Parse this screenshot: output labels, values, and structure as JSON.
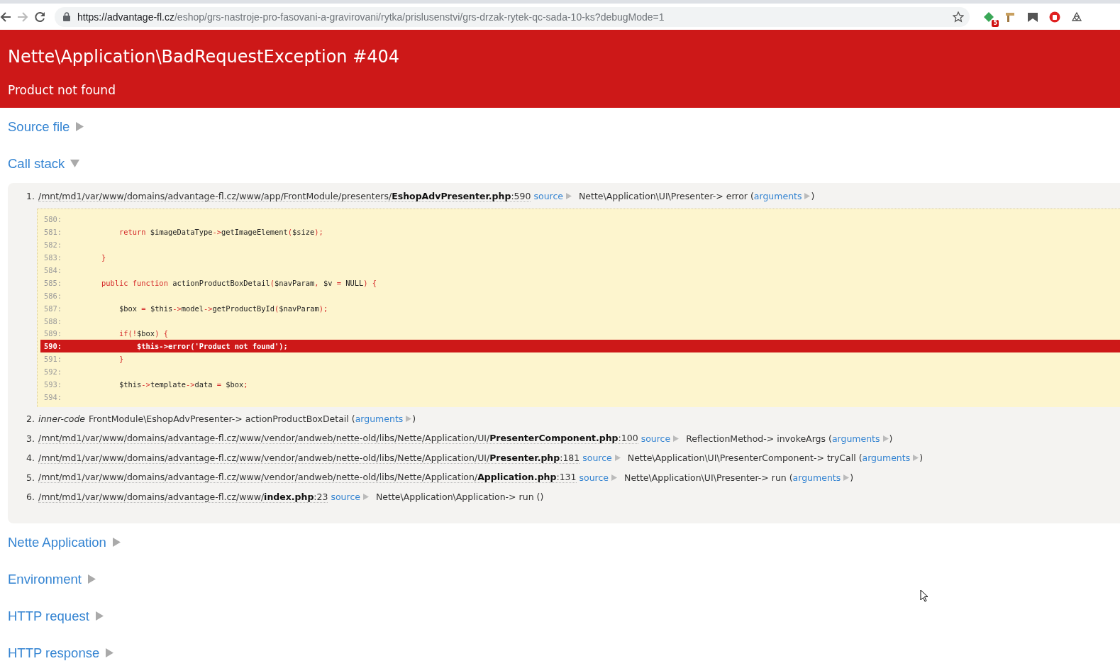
{
  "browser": {
    "back_disabled": false,
    "forward_disabled": true,
    "url_host": "https://advantage-fl.cz",
    "url_path": "/eshop/grs-nastroje-pro-fasovani-a-gravirovani/rytka/prislusenstvi/grs-drzak-rytek-qc-sada-10-ks?debugMode=1",
    "extension_badge": "5"
  },
  "error": {
    "title": "Nette\\Application\\BadRequestException #404",
    "message": "Product not found"
  },
  "sections": [
    {
      "title": "Source file",
      "expanded": false
    },
    {
      "title": "Call stack",
      "expanded": true,
      "frames": [
        {
          "kind": "file",
          "number": "1.",
          "location": "/mnt/md1/var/www/domains/advantage-fl.cz/www/app/FrontModule/presenters/**EshopAdvPresenter.php**:590",
          "source_link": "source",
          "call": "Nette\\Application\\UI\\Presenter-> error (",
          "arguments_link": "arguments",
          "close": ")",
          "code": [
            {
              "number": "580:",
              "highlighted": false
            },
            {
              "number": "581:",
              "highlighted": false,
              "segments": [
                {
                  "kind": "kw",
                  "text": "            return"
                },
                {
                  "kind": "tx",
                  "text": " $imageDataType"
                },
                {
                  "kind": "kw",
                  "text": "->"
                },
                {
                  "kind": "tx",
                  "text": "getImageElement"
                },
                {
                  "kind": "kw",
                  "text": "("
                },
                {
                  "kind": "tx",
                  "text": "$size"
                },
                {
                  "kind": "kw",
                  "text": ");"
                }
              ]
            },
            {
              "number": "582:",
              "highlighted": false
            },
            {
              "number": "583:",
              "highlighted": false,
              "segments": [
                {
                  "kind": "kw",
                  "text": "        }"
                }
              ]
            },
            {
              "number": "584:",
              "highlighted": false
            },
            {
              "number": "585:",
              "highlighted": false,
              "segments": [
                {
                  "kind": "kw",
                  "text": "        public function"
                },
                {
                  "kind": "tx",
                  "text": " actionProductBoxDetail"
                },
                {
                  "kind": "kw",
                  "text": "("
                },
                {
                  "kind": "tx",
                  "text": "$navParam"
                },
                {
                  "kind": "kw",
                  "text": ","
                },
                {
                  "kind": "tx",
                  "text": " $v "
                },
                {
                  "kind": "kw",
                  "text": "="
                },
                {
                  "kind": "tx",
                  "text": " NULL"
                },
                {
                  "kind": "kw",
                  "text": ") {"
                }
              ]
            },
            {
              "number": "586:",
              "highlighted": false
            },
            {
              "number": "587:",
              "highlighted": false,
              "segments": [
                {
                  "kind": "tx",
                  "text": "            $box "
                },
                {
                  "kind": "kw",
                  "text": "="
                },
                {
                  "kind": "tx",
                  "text": " $this"
                },
                {
                  "kind": "kw",
                  "text": "->"
                },
                {
                  "kind": "tx",
                  "text": "model"
                },
                {
                  "kind": "kw",
                  "text": "->"
                },
                {
                  "kind": "tx",
                  "text": "getProductById"
                },
                {
                  "kind": "kw",
                  "text": "("
                },
                {
                  "kind": "tx",
                  "text": "$navParam"
                },
                {
                  "kind": "kw",
                  "text": ");"
                }
              ]
            },
            {
              "number": "588:",
              "highlighted": false
            },
            {
              "number": "589:",
              "highlighted": false,
              "segments": [
                {
                  "kind": "kw",
                  "text": "            if(!"
                },
                {
                  "kind": "tx",
                  "text": "$box"
                },
                {
                  "kind": "kw",
                  "text": ") {"
                }
              ]
            },
            {
              "number": "590:",
              "highlighted": true,
              "segments": [
                {
                  "kind": "tx",
                  "text": "                $this->error('Product not found');"
                }
              ]
            },
            {
              "number": "591:",
              "highlighted": false,
              "segments": [
                {
                  "kind": "kw",
                  "text": "            }"
                }
              ]
            },
            {
              "number": "592:",
              "highlighted": false
            },
            {
              "number": "593:",
              "highlighted": false,
              "segments": [
                {
                  "kind": "tx",
                  "text": "            $this"
                },
                {
                  "kind": "kw",
                  "text": "->"
                },
                {
                  "kind": "tx",
                  "text": "template"
                },
                {
                  "kind": "kw",
                  "text": "->"
                },
                {
                  "kind": "tx",
                  "text": "data "
                },
                {
                  "kind": "kw",
                  "text": "="
                },
                {
                  "kind": "tx",
                  "text": " $box"
                },
                {
                  "kind": "kw",
                  "text": ";"
                }
              ]
            },
            {
              "number": "594:",
              "highlighted": false
            }
          ]
        },
        {
          "kind": "inner",
          "number": "2.",
          "label": "inner-code",
          "call": "FrontModule\\EshopAdvPresenter-> actionProductBoxDetail (",
          "arguments_link": "arguments",
          "close": ")"
        },
        {
          "kind": "file",
          "number": "3.",
          "location": "/mnt/md1/var/www/domains/advantage-fl.cz/www/vendor/andweb/nette-old/libs/Nette/Application/UI/**PresenterComponent.php**:100",
          "source_link": "source",
          "call": "ReflectionMethod-> invokeArgs (",
          "arguments_link": "arguments",
          "close": ")"
        },
        {
          "kind": "file",
          "number": "4.",
          "location": "/mnt/md1/var/www/domains/advantage-fl.cz/www/vendor/andweb/nette-old/libs/Nette/Application/UI/**Presenter.php**:181",
          "source_link": "source",
          "call": "Nette\\Application\\UI\\PresenterComponent-> tryCall (",
          "arguments_link": "arguments",
          "close": ")"
        },
        {
          "kind": "file",
          "number": "5.",
          "location": "/mnt/md1/var/www/domains/advantage-fl.cz/www/vendor/andweb/nette-old/libs/Nette/Application/**Application.php**:131",
          "source_link": "source",
          "call": "Nette\\Application\\UI\\Presenter-> run (",
          "arguments_link": "arguments",
          "close": ")"
        },
        {
          "kind": "file",
          "number": "6.",
          "location": "/mnt/md1/var/www/domains/advantage-fl.cz/www/**index.php**:23",
          "source_link": "source",
          "call": "Nette\\Application\\Application-> run ()"
        }
      ]
    },
    {
      "title": "Nette Application",
      "expanded": false
    },
    {
      "title": "Environment",
      "expanded": false
    },
    {
      "title": "HTTP request",
      "expanded": false
    },
    {
      "title": "HTTP response",
      "expanded": false
    }
  ]
}
